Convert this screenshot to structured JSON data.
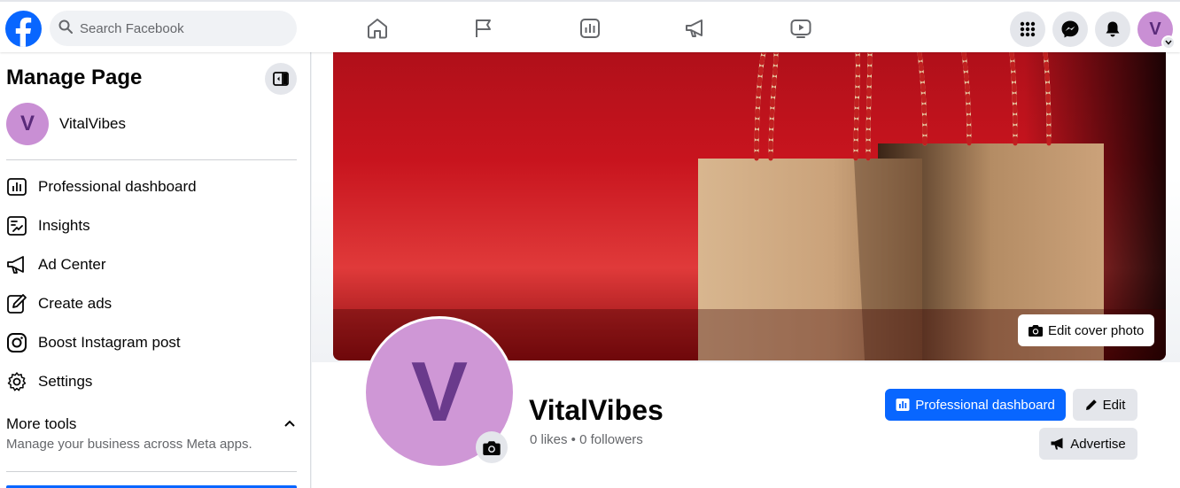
{
  "topbar": {
    "search_placeholder": "Search Facebook",
    "nav_icons": [
      "home-icon",
      "flag-icon",
      "chart-icon",
      "megaphone-icon",
      "video-icon"
    ],
    "right_icons": [
      "menu-grid-icon",
      "messenger-icon",
      "bell-icon"
    ],
    "avatar_letter": "V"
  },
  "sidebar": {
    "title": "Manage Page",
    "page_name": "VitalVibes",
    "page_avatar_letter": "V",
    "items": [
      {
        "label": "Professional dashboard",
        "icon": "dashboard-icon"
      },
      {
        "label": "Insights",
        "icon": "insights-icon"
      },
      {
        "label": "Ad Center",
        "icon": "megaphone-icon"
      },
      {
        "label": "Create ads",
        "icon": "pencil-icon"
      },
      {
        "label": "Boost Instagram post",
        "icon": "instagram-icon"
      },
      {
        "label": "Settings",
        "icon": "gear-icon"
      }
    ],
    "more_tools_title": "More tools",
    "more_tools_subtitle": "Manage your business across Meta apps."
  },
  "main": {
    "edit_cover_label": "Edit cover photo",
    "profile_letter": "V",
    "page_name": "VitalVibes",
    "stats": "0 likes • 0 followers",
    "professional_dashboard_label": "Professional dashboard",
    "edit_label": "Edit",
    "advertise_label": "Advertise"
  },
  "colors": {
    "brand_blue": "#0866ff",
    "avatar_purple": "#c98fd4",
    "cover_red": "#c8141e"
  }
}
